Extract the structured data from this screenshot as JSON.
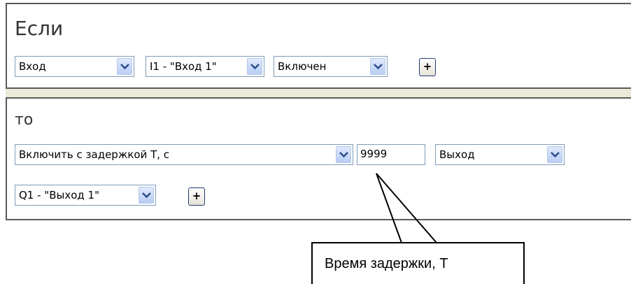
{
  "if_section": {
    "title": "Если",
    "input_type": "Вход",
    "input_channel": "I1 - \"Вход 1\"",
    "input_state": "Включен",
    "add_label": "+"
  },
  "then_section": {
    "title": "то",
    "action": "Включить с задержкой Т, с",
    "delay_value": "9999",
    "output_type": "Выход",
    "output_channel": "Q1 - \"Выход 1\"",
    "add_label": "+"
  },
  "callout": {
    "text": "Время задержки, Т"
  },
  "icons": {
    "dropdown": "chevron-down-icon"
  },
  "colors": {
    "panel_border": "#5a5a5a",
    "field_border": "#7f9db9",
    "dropdown_button": "#b9cdf5",
    "strip": "#ece9d8"
  }
}
